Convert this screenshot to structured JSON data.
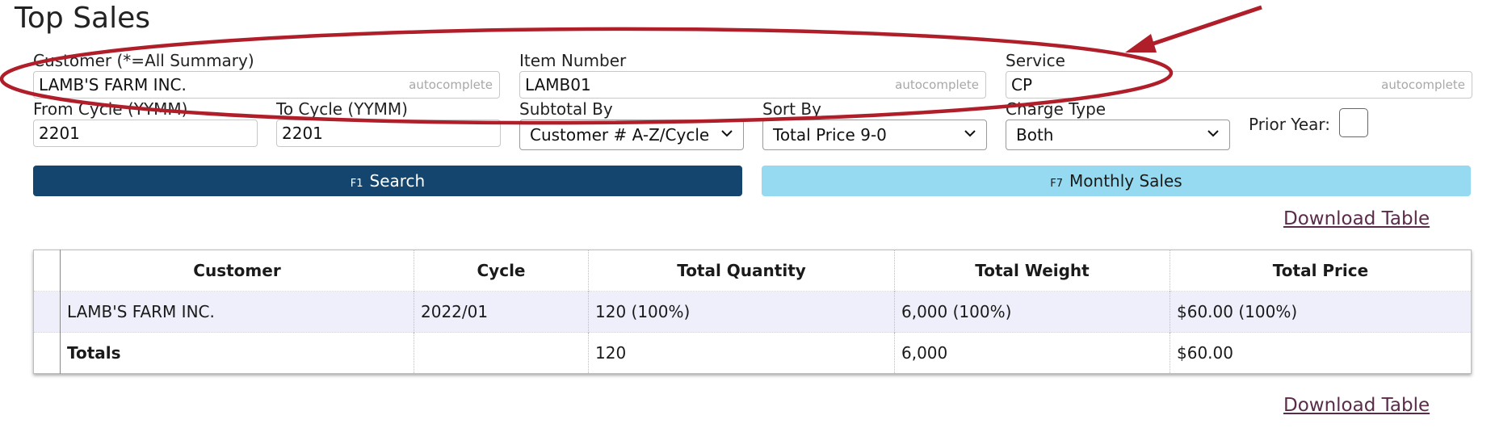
{
  "page": {
    "title": "Top Sales"
  },
  "filters": {
    "customer": {
      "label": "Customer (*=All Summary)",
      "value": "LAMB'S FARM INC.",
      "hint": "autocomplete"
    },
    "item_number": {
      "label": "Item Number",
      "value": "LAMB01",
      "hint": "autocomplete"
    },
    "service": {
      "label": "Service",
      "value": "CP",
      "hint": "autocomplete"
    },
    "from_cycle": {
      "label": "From Cycle (YYMM)",
      "value": "2201"
    },
    "to_cycle": {
      "label": "To Cycle (YYMM)",
      "value": "2201"
    },
    "subtotal_by": {
      "label": "Subtotal By",
      "selected": "Customer # A-Z/Cycle"
    },
    "sort_by": {
      "label": "Sort By",
      "selected": "Total Price 9-0"
    },
    "charge_type": {
      "label": "Charge Type",
      "selected": "Both"
    },
    "prior_year": {
      "label": "Prior Year:",
      "checked": false
    }
  },
  "actions": {
    "search": {
      "key": "F1",
      "label": "Search"
    },
    "monthly_sales": {
      "key": "F7",
      "label": "Monthly Sales"
    },
    "download_label": "Download Table"
  },
  "table": {
    "headers": [
      "Customer",
      "Cycle",
      "Total Quantity",
      "Total Weight",
      "Total Price"
    ],
    "rows": [
      [
        "LAMB'S FARM INC.",
        "2022/01",
        "120 (100%)",
        "6,000 (100%)",
        "$60.00 (100%)"
      ]
    ],
    "totals": [
      "Totals",
      "",
      "120",
      "6,000",
      "$60.00"
    ]
  },
  "colors": {
    "primary": "#14456f",
    "secondary": "#95daf0",
    "annotation": "#b01e2a",
    "link": "#5a2c4a"
  }
}
